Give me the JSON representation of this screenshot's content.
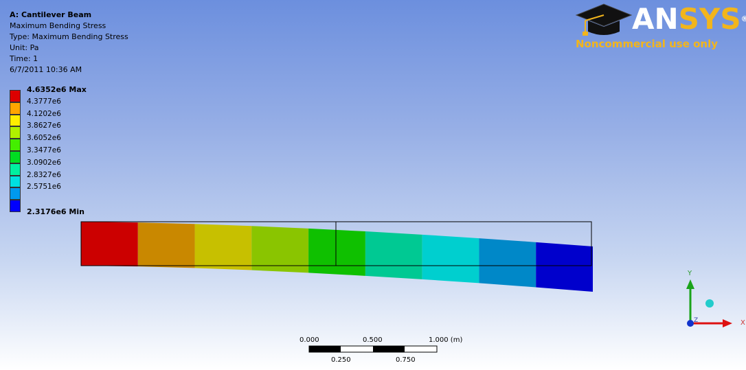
{
  "info": {
    "title": "A: Cantilever Beam",
    "result_name": "Maximum Bending Stress",
    "type": "Type: Maximum Bending Stress",
    "unit": "Unit: Pa",
    "time": "Time: 1",
    "date": "6/7/2011 10:36 AM"
  },
  "legend": [
    {
      "label": "4.6352e6 Max",
      "color": "#dd0000"
    },
    {
      "label": "4.3777e6",
      "color": "#ffa500"
    },
    {
      "label": "4.1202e6",
      "color": "#ffee00"
    },
    {
      "label": "3.8627e6",
      "color": "#b0f000"
    },
    {
      "label": "3.6052e6",
      "color": "#44ee00"
    },
    {
      "label": "3.3477e6",
      "color": "#00dd22"
    },
    {
      "label": "3.0902e6",
      "color": "#00f0a0"
    },
    {
      "label": "2.8327e6",
      "color": "#00e0e0"
    },
    {
      "label": "2.5751e6",
      "color": "#0099ee"
    },
    {
      "label": "2.3176e6 Min",
      "color": "#0000ff"
    }
  ],
  "beam_band_colors": [
    "#cc0000",
    "#c98800",
    "#c7c000",
    "#8ac500",
    "#0fc000",
    "#00c993",
    "#00cfcf",
    "#0088c8",
    "#0000cc"
  ],
  "logo": {
    "brand_part1": "AN",
    "brand_part2": "SYS",
    "registered": "®",
    "subtitle": "Noncommercial use only"
  },
  "triad": {
    "x_label": "X",
    "y_label": "Y",
    "z_label": "Z"
  },
  "scale": {
    "top_labels": [
      "0.000",
      "0.500",
      "1.000 (m)"
    ],
    "bottom_labels": [
      "0.250",
      "0.750"
    ]
  }
}
